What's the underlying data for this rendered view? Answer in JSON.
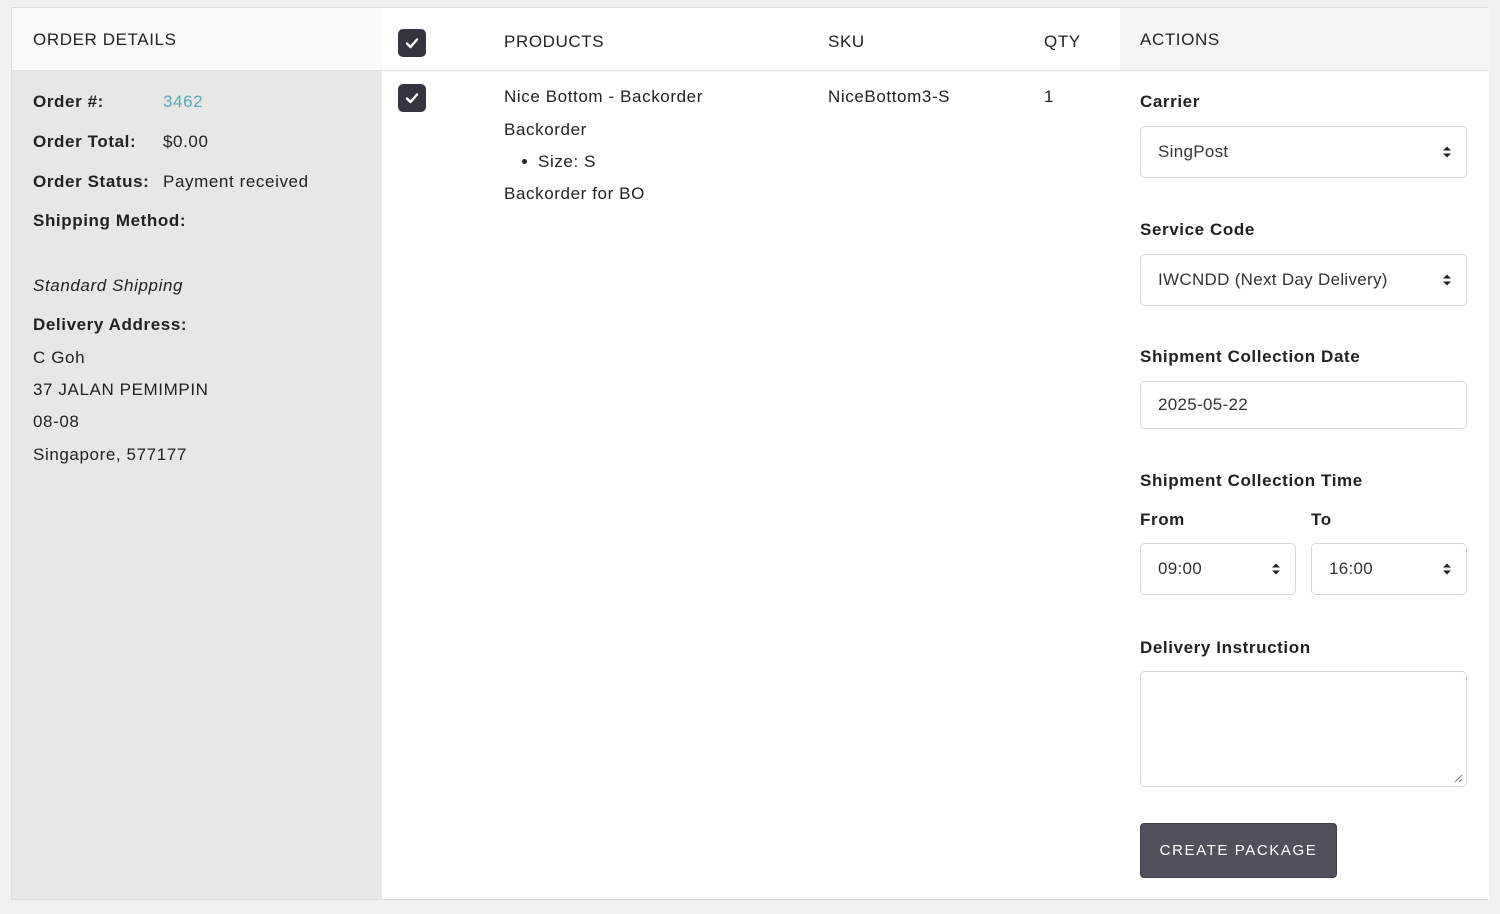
{
  "order_panel": {
    "title": "ORDER DETAILS",
    "order_number_label": "Order #:",
    "order_number": "3462",
    "order_total_label": "Order Total:",
    "order_total": "$0.00",
    "order_status_label": "Order Status:",
    "order_status": "Payment received",
    "shipping_method_label": "Shipping Method:",
    "shipping_method": "Standard Shipping",
    "delivery_address_label": "Delivery Address:",
    "address_lines": [
      "C Goh",
      "37 JALAN PEMIMPIN",
      "08-08",
      "Singapore, 577177"
    ]
  },
  "products_table": {
    "headers": {
      "products": "PRODUCTS",
      "sku": "SKU",
      "qty": "QTY"
    },
    "rows": [
      {
        "name": "Nice Bottom - Backorder",
        "status": "Backorder",
        "option": "Size: S",
        "note": "Backorder for BO",
        "sku": "NiceBottom3-S",
        "qty": "1",
        "checked": true
      }
    ],
    "select_all_checked": true
  },
  "actions": {
    "title": "ACTIONS",
    "carrier_label": "Carrier",
    "carrier_value": "SingPost",
    "service_code_label": "Service Code",
    "service_code_value": "IWCNDD (Next Day Delivery)",
    "collection_date_label": "Shipment Collection Date",
    "collection_date_value": "2025-05-22",
    "collection_time_label": "Shipment Collection Time",
    "from_label": "From",
    "from_value": "09:00",
    "to_label": "To",
    "to_value": "16:00",
    "delivery_instruction_label": "Delivery Instruction",
    "delivery_instruction_value": "",
    "create_button": "CREATE PACKAGE"
  },
  "colors": {
    "link": "#5aaab9",
    "button": "#51515e",
    "checkbox": "#343441",
    "left_panel": "#e6e7e7"
  }
}
